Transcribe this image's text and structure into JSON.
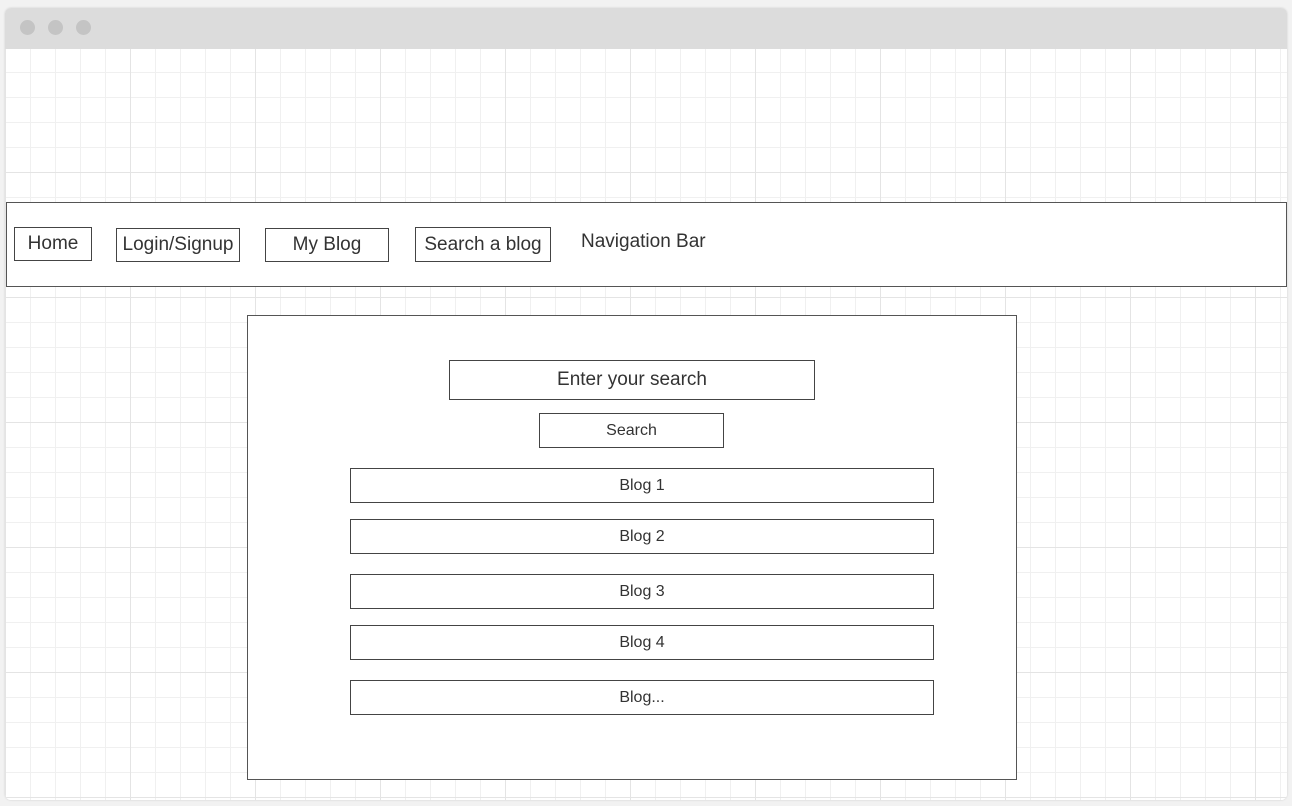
{
  "navbar": {
    "items": [
      {
        "label": "Home"
      },
      {
        "label": "Login/Signup"
      },
      {
        "label": "My Blog"
      },
      {
        "label": "Search a blog"
      }
    ],
    "caption": "Navigation Bar"
  },
  "search": {
    "placeholder": "Enter your search",
    "button_label": "Search"
  },
  "blogs": [
    {
      "label": "Blog 1"
    },
    {
      "label": "Blog 2"
    },
    {
      "label": "Blog 3"
    },
    {
      "label": "Blog 4"
    },
    {
      "label": "Blog..."
    }
  ],
  "colors": {
    "border": "#444444",
    "text": "#333333",
    "titlebar": "#dcdcdc",
    "grid": "#e4e4e4"
  }
}
